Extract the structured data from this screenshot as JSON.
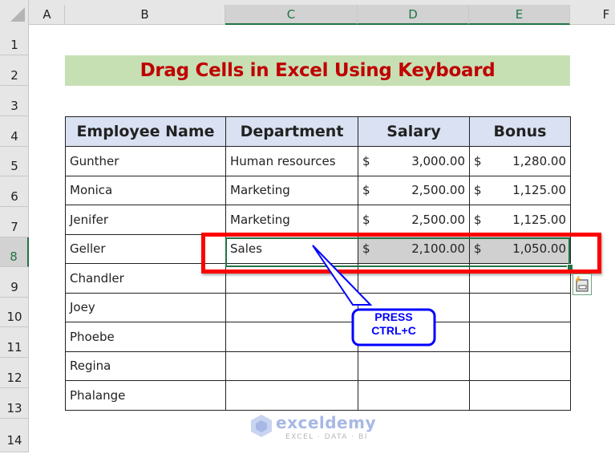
{
  "sheet": {
    "columns": [
      {
        "label": "A",
        "selected": false
      },
      {
        "label": "B",
        "selected": false
      },
      {
        "label": "C",
        "selected": true
      },
      {
        "label": "D",
        "selected": true
      },
      {
        "label": "E",
        "selected": true
      },
      {
        "label": "F",
        "selected": false
      }
    ],
    "rows": [
      "1",
      "2",
      "3",
      "4",
      "5",
      "6",
      "7",
      "8",
      "9",
      "10",
      "11",
      "12",
      "13",
      "14"
    ],
    "selected_row": "8",
    "accent_color": "#217346"
  },
  "title": {
    "text": "Drag Cells in Excel Using Keyboard",
    "color": "#c00000",
    "background": "#c6e0b4"
  },
  "table": {
    "headers": [
      "Employee Name",
      "Department",
      "Salary",
      "Bonus"
    ],
    "rows": [
      {
        "name": "Gunther",
        "department": "Human resources",
        "salary_cur": "$",
        "salary": "3,000.00",
        "bonus_cur": "$",
        "bonus": "1,280.00"
      },
      {
        "name": "Monica",
        "department": "Marketing",
        "salary_cur": "$",
        "salary": "2,500.00",
        "bonus_cur": "$",
        "bonus": "1,125.00"
      },
      {
        "name": "Jenifer",
        "department": "Marketing",
        "salary_cur": "$",
        "salary": "2,500.00",
        "bonus_cur": "$",
        "bonus": "1,125.00"
      },
      {
        "name": "Geller",
        "department": "Sales",
        "salary_cur": "$",
        "salary": "2,100.00",
        "bonus_cur": "$",
        "bonus": "1,050.00"
      },
      {
        "name": "Chandler",
        "department": "",
        "salary_cur": "",
        "salary": "",
        "bonus_cur": "",
        "bonus": ""
      },
      {
        "name": "Joey",
        "department": "",
        "salary_cur": "",
        "salary": "",
        "bonus_cur": "",
        "bonus": ""
      },
      {
        "name": "Phoebe",
        "department": "",
        "salary_cur": "",
        "salary": "",
        "bonus_cur": "",
        "bonus": ""
      },
      {
        "name": "Regina",
        "department": "",
        "salary_cur": "",
        "salary": "",
        "bonus_cur": "",
        "bonus": ""
      },
      {
        "name": "Phalange",
        "department": "",
        "salary_cur": "",
        "salary": "",
        "bonus_cur": "",
        "bonus": ""
      }
    ]
  },
  "callout": {
    "line1": "PRESS",
    "line2": "CTRL+C",
    "color": "#0000ff"
  },
  "highlight_color": "#ff0000",
  "paste_options_icon": "paste-options-icon",
  "watermark": {
    "name": "exceldemy",
    "tagline": "EXCEL · DATA · BI"
  }
}
